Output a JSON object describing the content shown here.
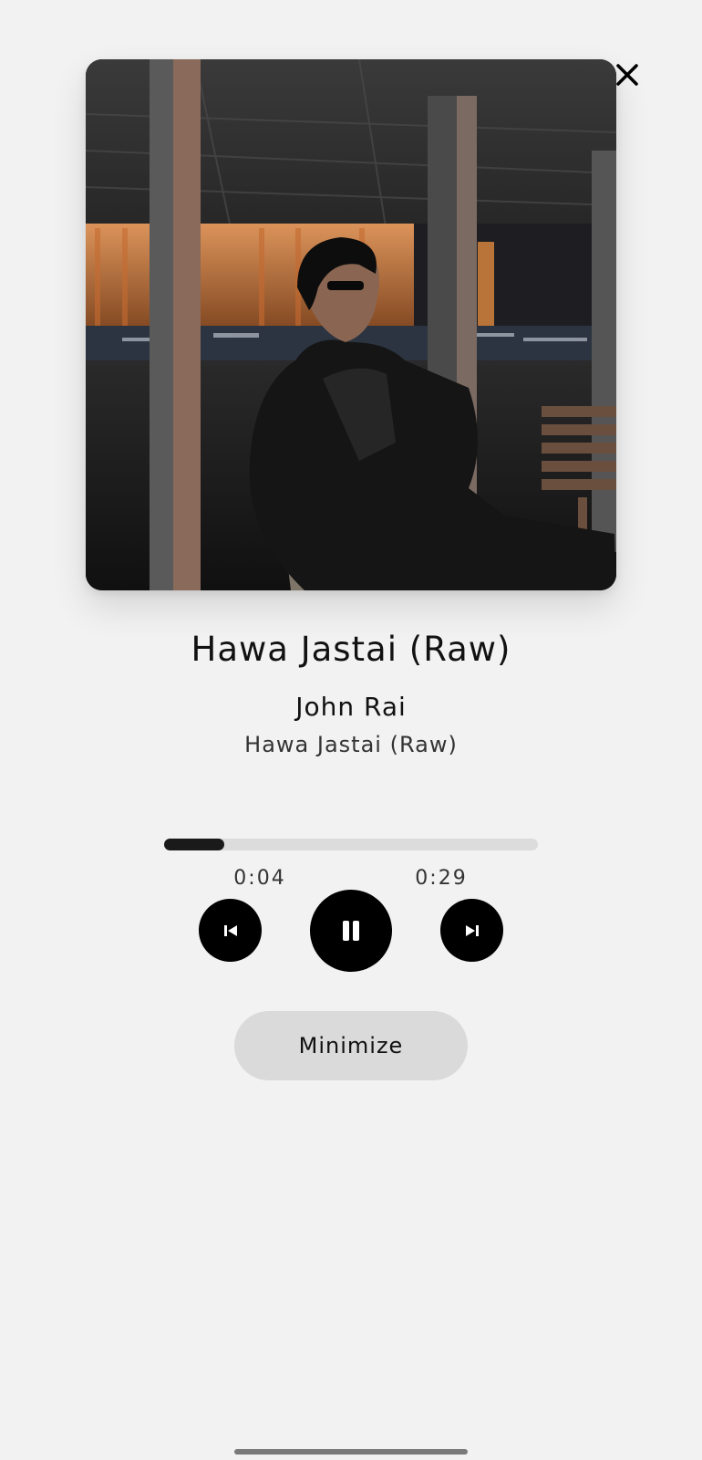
{
  "player": {
    "track_title": "Hawa Jastai (Raw)",
    "artist": "John Rai",
    "album": "Hawa Jastai (Raw)",
    "current_time": "0:04",
    "total_time": "0:29",
    "progress_fraction": 0.16,
    "state": "playing"
  },
  "buttons": {
    "minimize_label": "Minimize",
    "close_icon": "close-icon",
    "previous_icon": "skip-previous-icon",
    "play_pause_icon": "pause-icon",
    "next_icon": "skip-next-icon"
  },
  "colors": {
    "background": "#f2f2f2",
    "control_fill": "#000000",
    "progress_fill": "#1a1a1a",
    "progress_track": "#dcdcdc",
    "minimize_bg": "#dadada"
  }
}
